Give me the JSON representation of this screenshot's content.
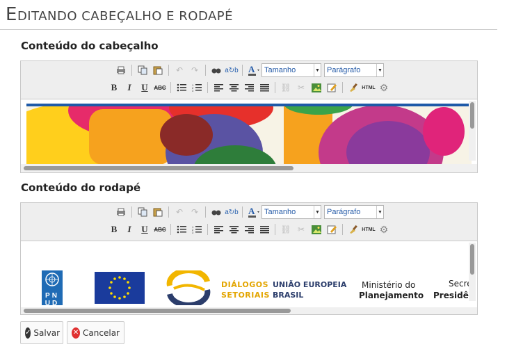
{
  "page": {
    "title_first": "E",
    "title_rest": "DITANDO CABEÇALHO E RODAPÉ"
  },
  "header_section": {
    "label": "Conteúdo do cabeçalho"
  },
  "footer_section": {
    "label": "Conteúdo do rodapé"
  },
  "toolbar": {
    "size_select": "Tamanho",
    "format_select": "Parágrafo",
    "bold": "B",
    "italic": "I",
    "underline": "U",
    "strike": "ABC",
    "html": "HTML",
    "icons": [
      "print-icon",
      "copy-icon",
      "paste-icon",
      "undo-icon",
      "redo-icon",
      "find-icon",
      "replace-icon",
      "text-color-icon",
      "bullet-list-icon",
      "numbered-list-icon",
      "align-left-icon",
      "align-center-icon",
      "align-right-icon",
      "justify-icon",
      "link-icon",
      "unlink-icon",
      "image-icon",
      "edit-icon",
      "clean-icon",
      "html-icon",
      "settings-icon"
    ]
  },
  "footer_logos": {
    "pnud_top": "PN",
    "pnud_bottom": "UD",
    "dialogos_1": "DIÁLOGOS",
    "dialogos_2": "SETORIAIS",
    "uniao_1": "UNIÃO EUROPEIA",
    "uniao_2": "BRASIL",
    "ministerio_1": "Ministério do",
    "ministerio_2": "Planejamento",
    "secretaria_1": "Secre",
    "secretaria_2": "Presidê"
  },
  "actions": {
    "save": "Salvar",
    "cancel": "Cancelar"
  },
  "colors": {
    "accent_blue": "#245aa7",
    "save_icon": "#333333",
    "cancel_icon": "#e03131"
  }
}
